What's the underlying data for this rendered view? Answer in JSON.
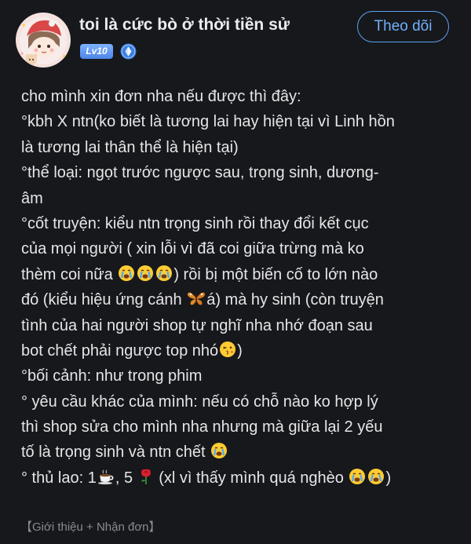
{
  "author": {
    "name": "toi là cức bò ở thời tiền sử",
    "level": "Lv10",
    "verified_icon": "diamond-badge-icon",
    "avatar_icon": "avatar-illustration"
  },
  "follow_button": {
    "label": "Theo dõi"
  },
  "content": {
    "lines": [
      {
        "text": "cho mình xin đơn nha nếu được thì đây:"
      },
      {
        "text": "°kbh X ntn(ko biết là tương lai hay hiện tại vì Linh hồn"
      },
      {
        "text": "là tương lai thân thể là hiện tại)"
      },
      {
        "text": "°thể loại: ngọt trước ngược sau, trọng sinh, dương-"
      },
      {
        "text": "âm"
      },
      {
        "text": "°cốt truyện: kiểu ntn trọng sinh rồi thay đổi kết cục"
      },
      {
        "text": "của mọi người ( xin lỗi vì đã coi giữa trừng mà ko"
      },
      {
        "pre": "thèm coi nữa ",
        "emojis": [
          "crying-face",
          "crying-face",
          "crying-face"
        ],
        "post": ") rồi bị một biến cố to lớn nào"
      },
      {
        "pre": "đó (kiểu hiệu ứng cánh ",
        "emojis": [
          "butterfly"
        ],
        "post": "á) mà hy sinh (còn truyện"
      },
      {
        "text": "tình của hai người shop tự nghĩ nha nhớ đoạn sau"
      },
      {
        "pre": "bot chết phải ngược top nhó",
        "emojis": [
          "kissing-face"
        ],
        "post": ")"
      },
      {
        "text": "°bối cảnh: như trong phim"
      },
      {
        "text": "° yêu cầu khác của mình: nếu có chỗ nào ko hợp lý"
      },
      {
        "text": "thì shop sửa cho mình nha nhưng mà giữa lại 2 yếu"
      },
      {
        "pre": "tố là trọng sinh và ntn chết ",
        "emojis": [
          "crying-face"
        ],
        "post": ""
      },
      {
        "pre": "° thủ lao: 1",
        "emojis": [
          "coffee-cup"
        ],
        "post": ", 5 ",
        "emojis2": [
          "rose"
        ],
        "post2": " (xl vì thấy mình quá nghèo ",
        "emojis3": [
          "crying-face",
          "crying-face"
        ],
        "post3": ")"
      }
    ]
  },
  "tags": {
    "label": "【Giới thiệu + Nhận đơn】"
  },
  "colors": {
    "background": "#17181c",
    "text": "#e6e6e8",
    "accent_blue": "#5aa3f5",
    "muted": "#8a8b90"
  }
}
